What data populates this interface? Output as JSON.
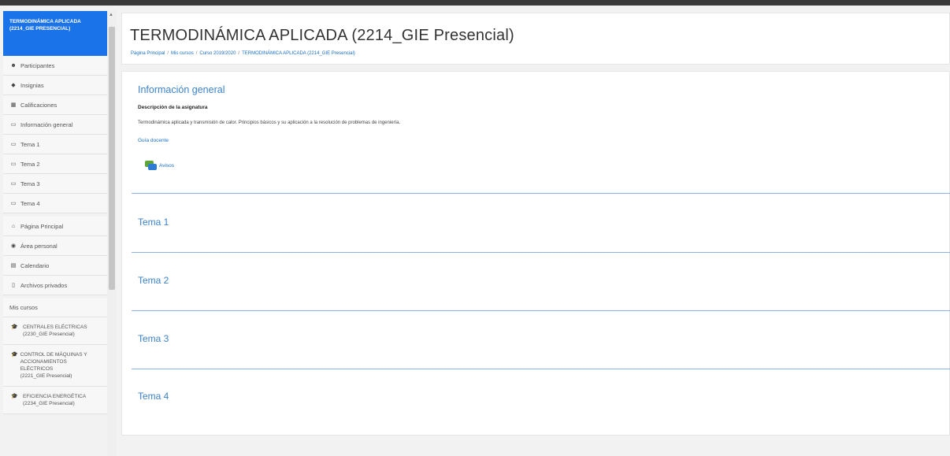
{
  "sidebar": {
    "active_course": "TERMODINÁMICA APLICADA (2214_GIE Presencial)",
    "nav": [
      {
        "icon": "participants-icon",
        "glyph": "☻",
        "label": "Participantes"
      },
      {
        "icon": "badge-icon",
        "glyph": "◆",
        "label": "Insignias"
      },
      {
        "icon": "grades-icon",
        "glyph": "▦",
        "label": "Calificaciones"
      },
      {
        "icon": "folder-icon",
        "glyph": "▭",
        "label": "Información general"
      },
      {
        "icon": "folder-icon",
        "glyph": "▭",
        "label": "Tema 1"
      },
      {
        "icon": "folder-icon",
        "glyph": "▭",
        "label": "Tema 2"
      },
      {
        "icon": "folder-icon",
        "glyph": "▭",
        "label": "Tema 3"
      },
      {
        "icon": "folder-icon",
        "glyph": "▭",
        "label": "Tema 4"
      }
    ],
    "nav2": [
      {
        "icon": "home-icon",
        "glyph": "⌂",
        "label": "Página Principal"
      },
      {
        "icon": "dashboard-icon",
        "glyph": "◉",
        "label": "Área personal"
      },
      {
        "icon": "calendar-icon",
        "glyph": "▤",
        "label": "Calendario"
      },
      {
        "icon": "file-icon",
        "glyph": "▯",
        "label": "Archivos privados"
      }
    ],
    "mis_cursos_label": "Mis cursos",
    "courses": [
      {
        "name": "CENTRALES ELÉCTRICAS",
        "code": "(2230_GIE Presencial)"
      },
      {
        "name": "CONTROL DE MÁQUINAS Y ACCIONAMIENTOS ELÉCTRICOS",
        "code": "(2221_GIE Presencial)"
      },
      {
        "name": "EFICIENCIA ENERGÉTICA",
        "code": "(2234_GIE Presencial)"
      }
    ]
  },
  "header": {
    "title": "TERMODINÁMICA APLICADA (2214_GIE Presencial)",
    "breadcrumb": [
      "Página Principal",
      "Mis cursos",
      "Curso 2019/2020",
      "TERMODINÁMICA APLICADA (2214_GIE Presencial)"
    ],
    "breadcrumb_sep": "/"
  },
  "main": {
    "general_title": "Información general",
    "desc_heading": "Descripción de la asignatura",
    "desc_text": "Termodinámica aplicada y transmisión de calor. Principios básicos y su aplicación a la resolución de problemas de ingeniería.",
    "guia_link": "Guía docente",
    "avisos_label": "Avisos",
    "temas": [
      "Tema 1",
      "Tema 2",
      "Tema 3",
      "Tema 4"
    ]
  },
  "colors": {
    "accent": "#1a73e8",
    "link": "#1a6fc4",
    "section_title": "#3c82c9"
  }
}
